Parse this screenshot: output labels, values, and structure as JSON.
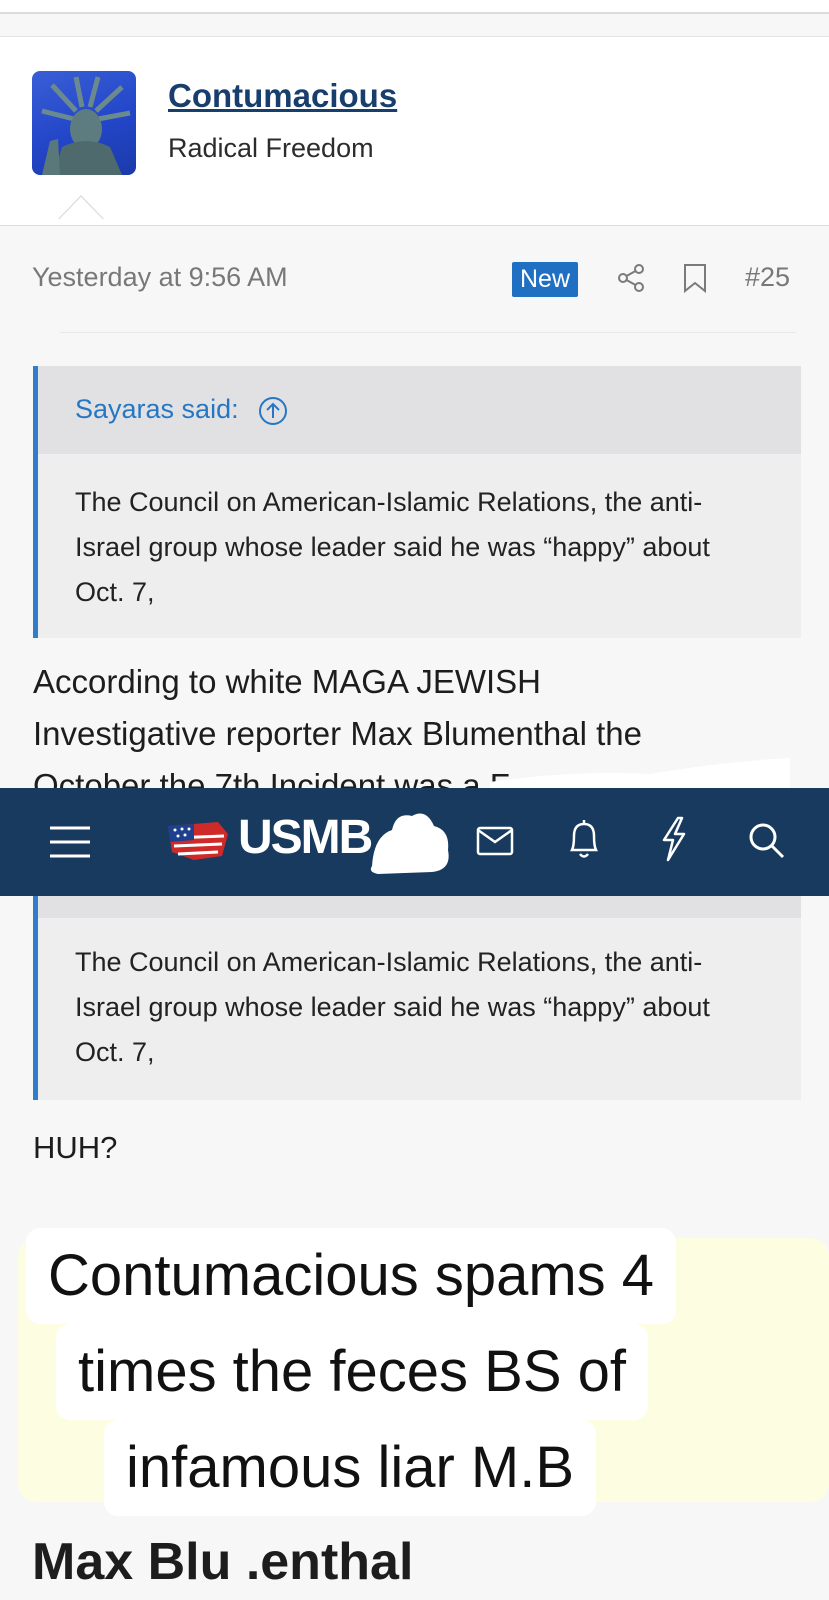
{
  "user": {
    "username": "Contumacious",
    "user_title": "Radical Freedom"
  },
  "post": {
    "timestamp": "Yesterday at 9:56 AM",
    "badge": "New",
    "number": "#25",
    "quote_attribution": "Sayaras said:",
    "quote_text": "The Council on American-Islamic Relations, the anti-Israel group whose leader said he was “happy” about Oct. 7,",
    "body_line_1": "According to white MAGA JEWISH",
    "body_line_2": "Investigative reporter Max Blumenthal the",
    "body_line_3": "October the 7th Incident was a F",
    "reply_text": "HUH?"
  },
  "navbar": {
    "logo": "USMB",
    "icons": [
      "menu-icon",
      "flag-icon",
      "mail-icon",
      "bell-icon",
      "bolt-icon",
      "search-icon"
    ]
  },
  "overlay": {
    "line_1": "Contumacious spams 4",
    "line_2": "times the feces BS of",
    "line_3": "infamous liar M.B"
  },
  "bottom_title": "Max Blu   .enthal",
  "colors": {
    "navbar": "#183a5e",
    "accent": "#2f7ecb",
    "username": "#183e6d",
    "badge": "#1f6fc2"
  }
}
